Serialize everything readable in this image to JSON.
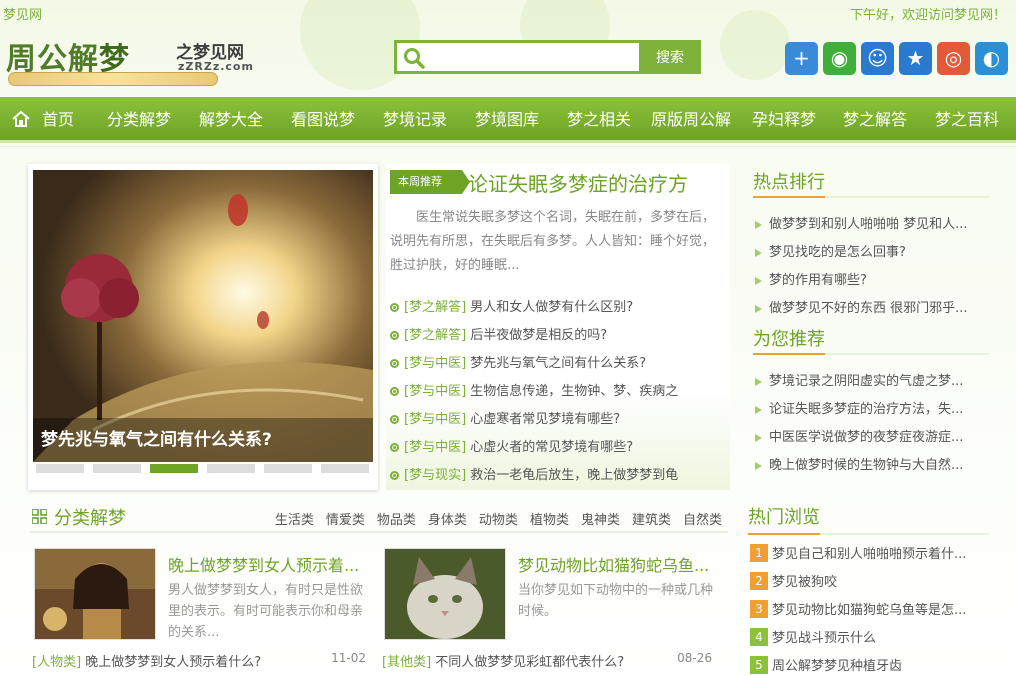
{
  "topbar": {
    "site_name": "梦见网",
    "greeting": "下午好，欢迎访问梦见网！"
  },
  "logo": {
    "title_a": "周公解",
    "title_b": "梦",
    "subtitle": "之梦见网",
    "domain": "zZRZz.com"
  },
  "search": {
    "placeholder": "",
    "button": "搜索"
  },
  "social": [
    {
      "icon": "plus-icon",
      "color": "#3a8bd7"
    },
    {
      "icon": "wechat-icon",
      "color": "#3fae3a"
    },
    {
      "icon": "qq-icon",
      "color": "#2a7bd0"
    },
    {
      "icon": "qzone-icon",
      "color": "#2a7bd0"
    },
    {
      "icon": "weibo-icon",
      "color": "#e25a3a"
    },
    {
      "icon": "tencent-weibo-icon",
      "color": "#2a8fd7"
    }
  ],
  "nav": [
    "首页",
    "分类解梦",
    "解梦大全",
    "看图说梦",
    "梦境记录",
    "梦境图库",
    "梦之相关",
    "原版周公解",
    "孕妇释梦",
    "梦之解答",
    "梦之百科"
  ],
  "slider": {
    "caption": "梦先兆与氧气之间有什么关系?",
    "active_index": 2,
    "dot_count": 6
  },
  "featured": {
    "badge": "本周推荐",
    "title": "论证失眠多梦症的治疗方",
    "desc": "医生常说失眠多梦这个名词，失眠在前，多梦在后，说明先有所思，在失眠后有多梦。人人皆知：睡个好觉，胜过护肤，好的睡眠...",
    "items": [
      {
        "cat": "[梦之解答]",
        "text": "男人和女人做梦有什么区别?"
      },
      {
        "cat": "[梦之解答]",
        "text": "后半夜做梦是相反的吗?"
      },
      {
        "cat": "[梦与中医]",
        "text": "梦先兆与氧气之间有什么关系?"
      },
      {
        "cat": "[梦与中医]",
        "text": "生物信息传递，生物钟、梦、疾病之"
      },
      {
        "cat": "[梦与中医]",
        "text": "心虚寒者常见梦境有哪些?"
      },
      {
        "cat": "[梦与中医]",
        "text": "心虚火者的常见梦境有哪些?"
      },
      {
        "cat": "[梦与现实]",
        "text": "救治一老龟后放生，晚上做梦梦到龟"
      }
    ]
  },
  "hot_rank": {
    "title": "热点排行",
    "items": [
      "做梦梦到和别人啪啪啪 梦见和人...",
      "梦见找吃的是怎么回事?",
      "梦的作用有哪些?",
      "做梦梦见不好的东西 很邪门邪乎..."
    ]
  },
  "recommend": {
    "title": "为您推荐",
    "items": [
      "梦境记录之阴阳虚实的气虚之梦...",
      "论证失眠多梦症的治疗方法，失...",
      "中医医学说做梦的夜梦症夜游症...",
      "晚上做梦时候的生物钟与大自然..."
    ]
  },
  "category": {
    "title": "分类解梦",
    "subcats": [
      "生活类",
      "情爱类",
      "物品类",
      "身体类",
      "动物类",
      "植物类",
      "鬼神类",
      "建筑类",
      "自然类"
    ],
    "cards": [
      {
        "title": "晚上做梦梦到女人预示着...",
        "desc": "男人做梦梦到女人，有时只是性欲里的表示。有时可能表示你和母亲的关系..."
      },
      {
        "title": "梦见动物比如猫狗蛇乌鱼...",
        "desc": "当你梦见如下动物中的一种或几种时候。"
      }
    ],
    "bottom": [
      {
        "cat": "[人物类]",
        "text": "晚上做梦梦到女人预示着什么?",
        "date": "11-02"
      },
      {
        "cat": "[其他类]",
        "text": "不同人做梦梦见彩虹都代表什么?",
        "date": "08-26"
      }
    ]
  },
  "hot_browse": {
    "title": "热门浏览",
    "items": [
      {
        "n": "1",
        "text": "梦见自己和别人啪啪啪预示着什...",
        "color": "#f0a030"
      },
      {
        "n": "2",
        "text": "梦见被狗咬",
        "color": "#f0a030"
      },
      {
        "n": "3",
        "text": "梦见动物比如猫狗蛇乌鱼等是怎...",
        "color": "#f0a030"
      },
      {
        "n": "4",
        "text": "梦见战斗预示什么",
        "color": "#8cc13c"
      },
      {
        "n": "5",
        "text": "周公解梦梦见种植牙齿",
        "color": "#8cc13c"
      }
    ]
  }
}
